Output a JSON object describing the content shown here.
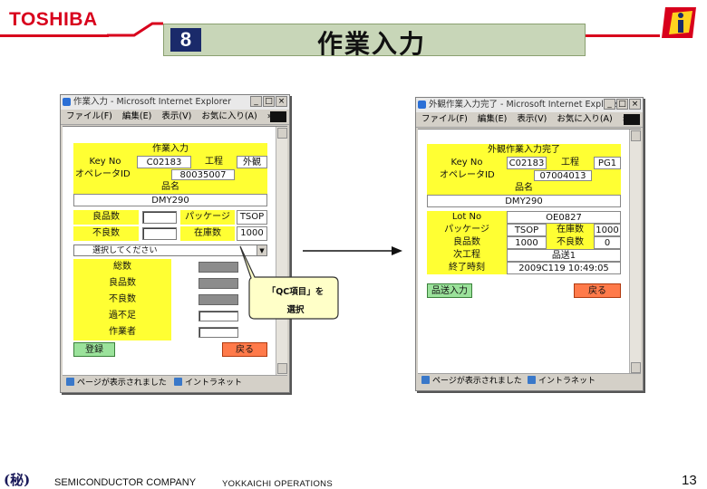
{
  "header": {
    "logo": "TOSHIBA",
    "step_number": "8",
    "title": "作業入力"
  },
  "colors": {
    "accent_red": "#d8001c",
    "field_yellow": "#ffff33",
    "button_green": "#9be29b",
    "button_orange": "#ff7a4a",
    "title_band": "#c8d6b8"
  },
  "browser": {
    "menu": [
      "ファイル(F)",
      "編集(E)",
      "表示(V)",
      "お気に入り(A)",
      "»"
    ],
    "status_left": "ページが表示されました",
    "status_right": "イントラネット",
    "window_buttons": [
      "_",
      "□",
      "×"
    ]
  },
  "left_window": {
    "title": "作業入力 - Microsoft Internet Explorer",
    "form_title": "作業入力",
    "keyno_label": "Key No",
    "keyno_value": "C02183",
    "koutei_label": "工程",
    "koutei_value": "外観",
    "operator_label": "オペレータID",
    "operator_value": "80035007",
    "hinmei_label": "品名",
    "hinmei_value": "DMY290",
    "ryouhin_label": "良品数",
    "package_label": "パッケージ",
    "package_value": "TSOP",
    "furyou_label": "不良数",
    "zaiko_label": "在庫数",
    "zaiko_value": "1000",
    "select_placeholder": "選択してください",
    "qc_rows": [
      "総数",
      "良品数",
      "不良数",
      "過不足",
      "作業者"
    ],
    "submit_label": "登録",
    "back_label": "戻る"
  },
  "callout": {
    "line1": "「QC項目」を",
    "line2": "選択"
  },
  "right_window": {
    "title": "外観作業入力完了 - Microsoft Internet Explorer",
    "form_title": "外観作業入力完了",
    "keyno_label": "Key No",
    "keyno_value": "C02183",
    "koutei_label": "工程",
    "koutei_value": "PG1",
    "operator_label": "オペレータID",
    "operator_value": "07004013",
    "hinmei_label": "品名",
    "hinmei_value": "DMY290",
    "lotno_label": "Lot No",
    "lotno_value": "OE0827",
    "package_label": "パッケージ",
    "package_value": "TSOP",
    "zaiko_label": "在庫数",
    "zaiko_value": "1000",
    "ryouhin_label": "良品数",
    "ryouhin_value": "1000",
    "furyou_label": "不良数",
    "furyou_value": "0",
    "jikoutei_label": "次工程",
    "jikoutei_value": "品送1",
    "shuuryou_label": "終了時刻",
    "shuuryou_value": "2009C119 10:49:05",
    "hinsou_label": "品送入力",
    "back_label": "戻る"
  },
  "footer": {
    "confidential_mark": "(秘)",
    "company": "SEMICONDUCTOR COMPANY",
    "operations": "YOKKAICHI OPERATIONS",
    "page_number": "13"
  }
}
